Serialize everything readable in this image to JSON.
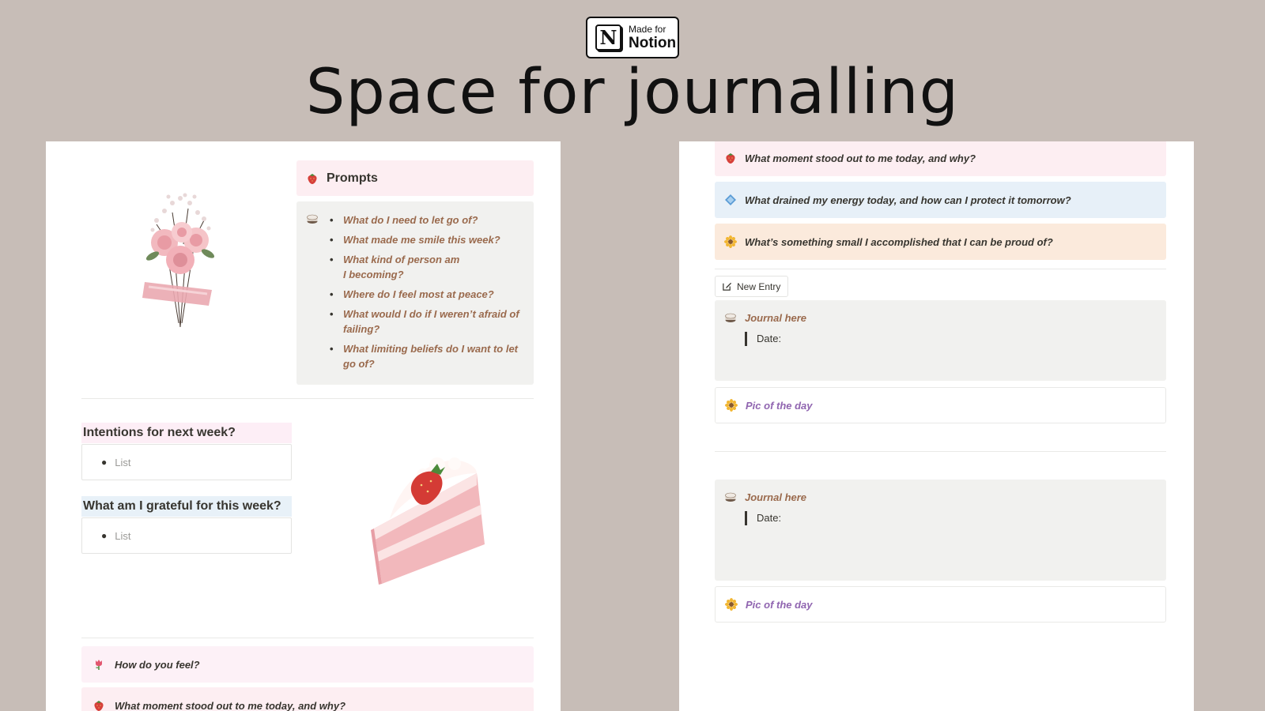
{
  "badge": {
    "line1": "Made for",
    "line2": "Notion"
  },
  "headline": "Space for journalling",
  "left_panel": {
    "prompts": {
      "heading": "Prompts",
      "items": [
        "What do I need to let go of?",
        "What made me smile this week?",
        "What kind of person am I becoming?",
        "Where do I feel most at peace?",
        "What would I do if I weren’t afraid of failing?",
        "What limiting beliefs do I want to let go of?"
      ]
    },
    "intentions": {
      "heading": "Intentions for next week?",
      "placeholder": "List"
    },
    "grateful": {
      "heading": "What am I grateful for this week?",
      "placeholder": "List"
    },
    "callouts": [
      {
        "icon": "tulip-icon",
        "text": "How do you feel?"
      },
      {
        "icon": "strawberry-icon",
        "text": "What moment stood out to me today, and why?"
      }
    ]
  },
  "right_panel": {
    "callouts": [
      {
        "icon": "strawberry-icon",
        "text": "What moment stood out to me today, and why?",
        "color": "#fdeef2"
      },
      {
        "icon": "diamond-icon",
        "text": "What drained my energy today, and how can I protect it tomorrow?",
        "color": "#e7f0f8"
      },
      {
        "icon": "sunflower-icon",
        "text": "What’s something small I accomplished that I can be proud of?",
        "color": "#fbeadc"
      }
    ],
    "new_entry_label": "New Entry",
    "entries": [
      {
        "journal_label": "Journal here",
        "date_label": "Date:",
        "pic_label": "Pic of the day"
      },
      {
        "journal_label": "Journal here",
        "date_label": "Date:",
        "pic_label": "Pic of the day"
      }
    ]
  },
  "colors": {
    "background": "#c7bdb7",
    "prompt_text": "#9a6a4d",
    "pic_text": "#9065b0",
    "pink_callout": "#fdeef2",
    "blue_callout": "#e7f0f8",
    "orange_callout": "#fbeadc",
    "gray_block": "#f1f1ef"
  }
}
